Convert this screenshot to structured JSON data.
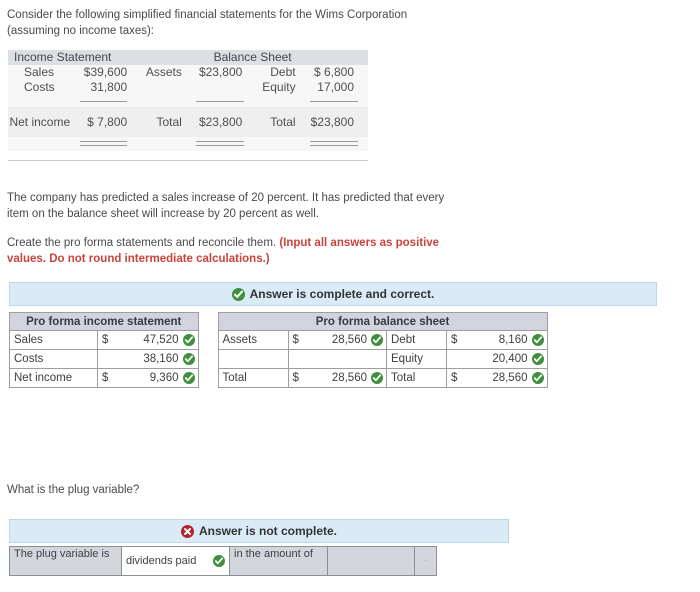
{
  "intro": {
    "line1": "Consider the following simplified financial statements for the Wims Corporation",
    "line2": "(assuming no income taxes):"
  },
  "given_statements": {
    "income_header": "Income Statement",
    "balance_header": "Balance Sheet",
    "rows": [
      {
        "is_label": "Sales",
        "is_value": "$39,600",
        "bs_left_label": "Assets",
        "bs_left_value": "$23,800",
        "bs_right_label": "Debt",
        "bs_right_value": "$  6,800"
      },
      {
        "is_label": "Costs",
        "is_value": "31,800",
        "bs_left_label": "",
        "bs_left_value": "",
        "bs_right_label": "Equity",
        "bs_right_value": "17,000"
      }
    ],
    "total_row": {
      "is_label": "Net income",
      "is_value": "$  7,800",
      "bs_left_label": "Total",
      "bs_left_value": "$23,800",
      "bs_right_label": "Total",
      "bs_right_value": "$23,800"
    }
  },
  "prose": {
    "paragraph1_a": "The company has predicted a sales increase of 20 percent. It has predicted that every",
    "paragraph1_b": "item on the balance sheet will increase by 20 percent as well.",
    "paragraph2_plain": "Create the pro forma statements and reconcile them. ",
    "paragraph2_bold_a": "(Input all answers as positive",
    "paragraph2_bold_b": "values. Do not round intermediate calculations.)"
  },
  "banner_correct": {
    "icon": "check-circle-icon",
    "text": "Answer is complete and correct."
  },
  "banner_incomplete": {
    "icon": "error-circle-icon",
    "text": "Answer is not complete."
  },
  "answer_tables": {
    "income_header": "Pro forma income statement",
    "balance_header": "Pro forma balance sheet",
    "income_rows": [
      {
        "label": "Sales",
        "dollar": "$",
        "value": "47,520",
        "status": "correct"
      },
      {
        "label": "Costs",
        "dollar": "",
        "value": "38,160",
        "status": "correct"
      },
      {
        "label": "Net income",
        "dollar": "$",
        "value": "9,360",
        "status": "correct"
      }
    ],
    "balance_left_rows": [
      {
        "label": "Assets",
        "dollar": "$",
        "value": "28,560",
        "status": "correct"
      },
      {
        "label": "",
        "dollar": "",
        "value": "",
        "status": "none"
      },
      {
        "label": "Total",
        "dollar": "$",
        "value": "28,560",
        "status": "correct"
      }
    ],
    "balance_right_rows": [
      {
        "label": "Debt",
        "dollar": "$",
        "value": "8,160",
        "status": "correct"
      },
      {
        "label": "Equity",
        "dollar": "",
        "value": "20,400",
        "status": "correct"
      },
      {
        "label": "Total",
        "dollar": "$",
        "value": "28,560",
        "status": "correct"
      }
    ]
  },
  "question2": {
    "prompt": "What is the plug variable?",
    "cell_prefix": "The plug variable is",
    "selected_answer": "dividends paid",
    "selected_status": "correct",
    "cell_middle": "in the amount of",
    "amount_value": "",
    "trailing_mark": "·"
  },
  "colors": {
    "banner_bg": "#daebf7",
    "banner_border": "#bcd6ea",
    "header_gray": "#d2d3de",
    "given_header_gray": "#dcdfe4",
    "correct_green": "#3f8f3f",
    "error_red": "#b2232b",
    "bold_red_text": "#c9443c"
  }
}
